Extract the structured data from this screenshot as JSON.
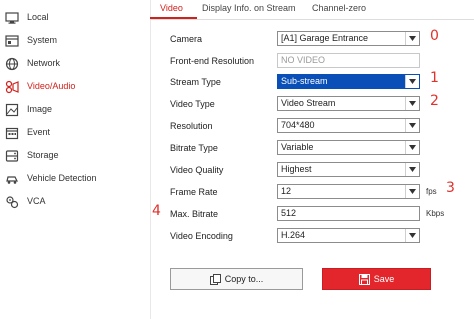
{
  "sidebar": {
    "items": [
      {
        "label": "Local",
        "icon": "monitor-icon"
      },
      {
        "label": "System",
        "icon": "system-icon"
      },
      {
        "label": "Network",
        "icon": "globe-icon"
      },
      {
        "label": "Video/Audio",
        "icon": "video-audio-icon",
        "active": true
      },
      {
        "label": "Image",
        "icon": "image-icon"
      },
      {
        "label": "Event",
        "icon": "calendar-icon"
      },
      {
        "label": "Storage",
        "icon": "storage-icon"
      },
      {
        "label": "Vehicle Detection",
        "icon": "vehicle-detection-icon"
      },
      {
        "label": "VCA",
        "icon": "vca-icon"
      }
    ]
  },
  "tabs": [
    {
      "label": "Video",
      "active": true
    },
    {
      "label": "Display Info. on Stream"
    },
    {
      "label": "Channel-zero"
    }
  ],
  "form": {
    "camera": {
      "label": "Camera",
      "value": "[A1] Garage Entrance"
    },
    "frontend_resolution": {
      "label": "Front-end Resolution",
      "value": "NO VIDEO"
    },
    "stream_type": {
      "label": "Stream Type",
      "value": "Sub-stream"
    },
    "video_type": {
      "label": "Video Type",
      "value": "Video Stream"
    },
    "resolution": {
      "label": "Resolution",
      "value": "704*480"
    },
    "bitrate_type": {
      "label": "Bitrate Type",
      "value": "Variable"
    },
    "video_quality": {
      "label": "Video Quality",
      "value": "Highest"
    },
    "frame_rate": {
      "label": "Frame Rate",
      "value": "12",
      "unit": "fps"
    },
    "max_bitrate": {
      "label": "Max. Bitrate",
      "value": "512",
      "unit": "Kbps"
    },
    "video_encoding": {
      "label": "Video Encoding",
      "value": "H.264"
    }
  },
  "annotations": [
    "0",
    "1",
    "2",
    "3",
    "4"
  ],
  "buttons": {
    "copy_label": "Copy to...",
    "save_label": "Save"
  },
  "colors": {
    "accent": "#d0221d",
    "save_button": "#e2262b",
    "selection": "#0a4fb7",
    "annotation": "#e0312b"
  }
}
